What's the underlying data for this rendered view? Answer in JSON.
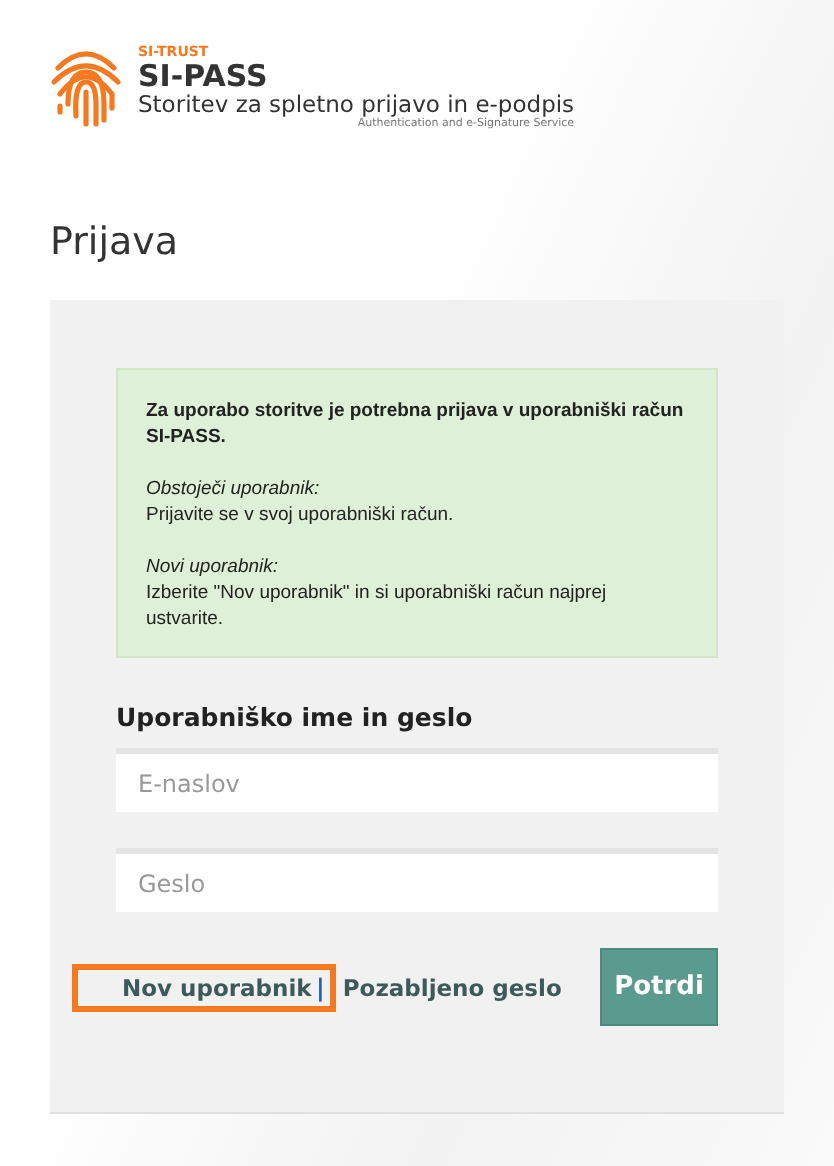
{
  "brand": {
    "company": "SI-TRUST",
    "product": "SI-PASS",
    "tagline": "Storitev za spletno prijavo in e-podpis",
    "subtitle": "Authentication and e-Signature Service"
  },
  "page_title": "Prijava",
  "notice": {
    "intro": "Za uporabo storitve je potrebna prijava v uporabniški račun SI-PASS.",
    "sections": [
      {
        "heading": "Obstoječi uporabnik:",
        "text": "Prijavite se v svoj uporabniški račun."
      },
      {
        "heading": "Novi uporabnik:",
        "text": "Izberite \"Nov uporabnik\" in si uporabniški račun najprej ustvarite."
      }
    ]
  },
  "form": {
    "heading": "Uporabniško ime in geslo",
    "fields": [
      {
        "placeholder": "E-naslov"
      },
      {
        "placeholder": "Geslo"
      }
    ],
    "links": [
      {
        "label": "Nov uporabnik",
        "highlighted": true
      },
      {
        "label": "Pozabljeno geslo",
        "highlighted": false
      }
    ],
    "separator": "|",
    "submit": "Potrdi"
  }
}
